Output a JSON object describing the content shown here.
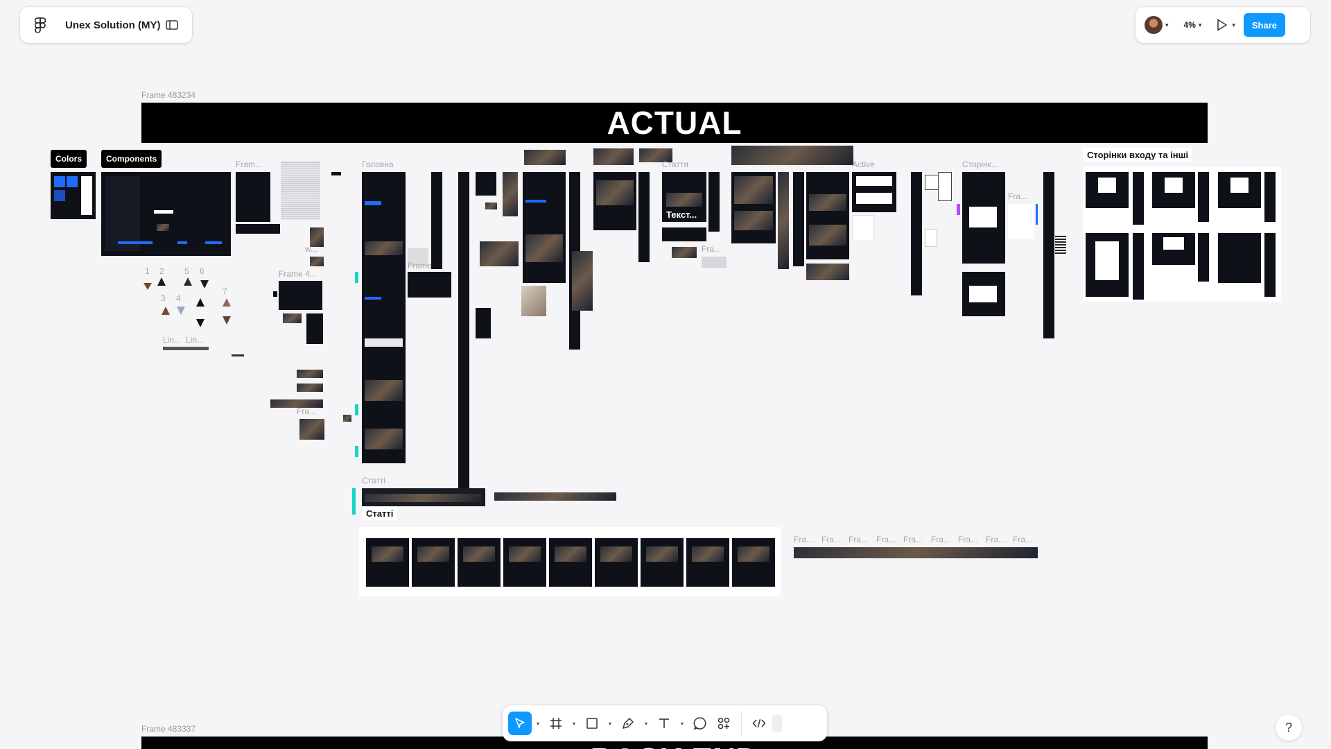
{
  "file": {
    "name": "Unex Solution (MY)"
  },
  "toolbar_right": {
    "zoom": "4%",
    "share_label": "Share"
  },
  "canvas": {
    "frame_top_label": "Frame 483234",
    "frame_bottom_label": "Frame 483337",
    "banner_top": "ACTUAL",
    "banner_bottom": "BACK END",
    "tags": {
      "colors": "Colors",
      "components": "Components",
      "login_pages": "Сторінки входу та інші",
      "articles_tag": "Статті"
    },
    "labels": {
      "fram": "Fram...",
      "holovna": "Головна",
      "frame4": "Frame 4...",
      "frame_short": "Frame",
      "w": "w...",
      "fra": "Fra...",
      "statti": "Статті",
      "stattia": "Стаття",
      "tekst": "Текст...",
      "active": "Active",
      "storinky": "Сторінк...",
      "lin1": "Lin...",
      "lin2": "Lin...",
      "dots": "..."
    },
    "numbers": [
      "1",
      "2",
      "3",
      "4",
      "5",
      "6",
      "7"
    ],
    "fra_row": [
      "Fra...",
      "Fra...",
      "Fra...",
      "Fra...",
      "Fra...",
      "Fra...",
      "Fra...",
      "Fra...",
      "Fra..."
    ]
  },
  "colors": {
    "accent": "#0d99ff",
    "brand_blue": "#1f6bff",
    "canvas_bg": "#f5f4f7",
    "selection_teal": "#19d3c5"
  },
  "icons": [
    "figma-logo-icon",
    "sidebar-toggle-icon",
    "avatar",
    "chevron-down-icon",
    "play-icon",
    "move-icon",
    "frame-icon",
    "rectangle-icon",
    "pen-icon",
    "text-icon",
    "comment-icon",
    "actions-icon",
    "dev-mode-icon",
    "help-icon"
  ]
}
